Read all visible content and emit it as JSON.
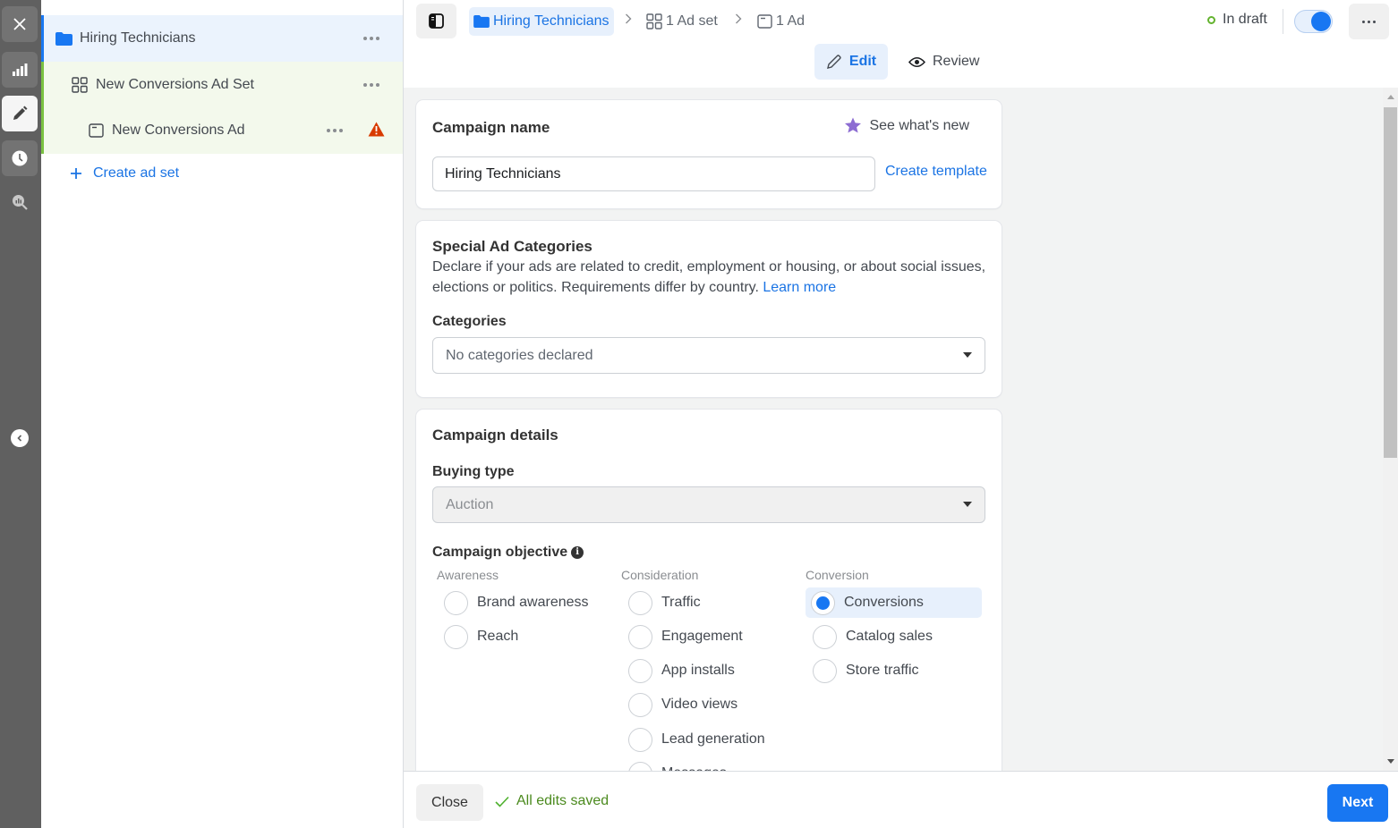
{
  "rail": {
    "items": [
      {
        "icon": "close-icon"
      },
      {
        "icon": "chart-icon"
      },
      {
        "icon": "pencil-icon",
        "active": true
      },
      {
        "icon": "clock-icon"
      },
      {
        "icon": "search-chart-icon"
      }
    ],
    "collapse_icon": "chevron-left-icon"
  },
  "tree": {
    "campaign": {
      "label": "Hiring Technicians",
      "icon": "folder-icon"
    },
    "adset": {
      "label": "New Conversions Ad Set",
      "icon": "grid-icon"
    },
    "ad": {
      "label": "New Conversions Ad",
      "icon": "ad-icon",
      "warning": true
    },
    "create_adset_label": "Create ad set"
  },
  "header": {
    "breadcrumb": {
      "campaign": "Hiring Technicians",
      "adset": "1 Ad set",
      "ad": "1 Ad"
    },
    "status": "In draft",
    "toggle_on": true,
    "tabs": {
      "edit": "Edit",
      "review": "Review"
    }
  },
  "campaign_name_card": {
    "title": "Campaign name",
    "see_whats_new": "See what's new",
    "name_value": "Hiring Technicians",
    "create_template": "Create template"
  },
  "special_ad_card": {
    "title": "Special Ad Categories",
    "description": "Declare if your ads are related to credit, employment or housing, or about social issues, elections or politics. Requirements differ by country.",
    "learn_more": "Learn more",
    "categories_label": "Categories",
    "categories_value": "No categories declared"
  },
  "campaign_details_card": {
    "title": "Campaign details",
    "buying_type_label": "Buying type",
    "buying_type_value": "Auction",
    "objective_label": "Campaign objective",
    "columns": [
      {
        "heading": "Awareness",
        "options": [
          "Brand awareness",
          "Reach"
        ]
      },
      {
        "heading": "Consideration",
        "options": [
          "Traffic",
          "Engagement",
          "App installs",
          "Video views",
          "Lead generation",
          "Messages"
        ]
      },
      {
        "heading": "Conversion",
        "options": [
          "Conversions",
          "Catalog sales",
          "Store traffic"
        ]
      }
    ],
    "selected": "Conversions"
  },
  "footer": {
    "close_label": "Close",
    "saved_status": "All edits saved",
    "next_label": "Next"
  },
  "colors": {
    "accent": "#1877f2",
    "success": "#4b8a1e",
    "warning": "#d83b01",
    "star": "#8c6cd2"
  }
}
